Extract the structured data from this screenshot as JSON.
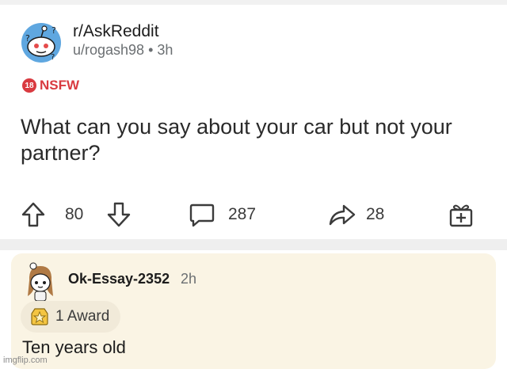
{
  "post": {
    "subreddit": "r/AskReddit",
    "meta": "u/rogash98 • 3h",
    "nsfw": {
      "badge": "18",
      "label": "NSFW"
    },
    "title": "What can you say about your car but not your partner?",
    "upvotes": "80",
    "comments": "287",
    "shares": "28"
  },
  "comment": {
    "username": "Ok-Essay-2352",
    "time": "2h",
    "award": "1 Award",
    "body": "Ten years old"
  },
  "watermark": "imgflip.com",
  "colors": {
    "nsfw": "#d93a40",
    "comment_bg": "#faf4e4",
    "award_bg": "#f1ead9"
  },
  "icons": [
    "subreddit-avatar-icon",
    "upvote-icon",
    "downvote-icon",
    "comment-icon",
    "share-icon",
    "gift-icon",
    "user-avatar-icon",
    "award-icon"
  ]
}
